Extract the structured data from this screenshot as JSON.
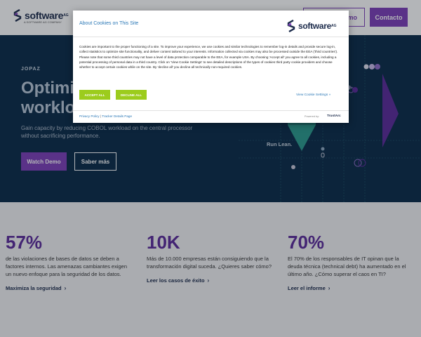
{
  "header": {
    "logo_text": "software",
    "logo_sup": "AG",
    "logo_tagline": "A SOFTWARE AG COMPANY",
    "demo_label": "emo",
    "contact_label": "Contacto"
  },
  "hero": {
    "eyebrow": "JOPAZ",
    "title_line1": "Optimiz",
    "title_line2": "workloa",
    "description": "Gain capacity by reducing COBOL workload on the central processor without sacrificing performance.",
    "watch_label": "Watch Demo",
    "more_label": "Saber más",
    "art_label": "Run Lean.",
    "art_label2": "ig."
  },
  "stats": [
    {
      "number": "57%",
      "text": "de las violaciones de bases de datos se deben a factores internos. Las amenazas cambiantes exigen un nuevo enfoque para la seguridad de los datos.",
      "link": "Maximiza la seguridad"
    },
    {
      "number": "10K",
      "text": "Más de 10.000 empresas están consiguiendo que la transformación digital suceda. ¿Quieres saber cómo?",
      "link": "Leer los casos de éxito"
    },
    {
      "number": "70%",
      "text": "El 70% de los responsables de IT opinan que la deuda técnica (technical debt) ha aumentado en el último año. ¿Cómo superar el caos en TI?",
      "link": "Leer el informe"
    }
  ],
  "cookie": {
    "title": "About Cookies on This Site",
    "logo_text": "software",
    "logo_sup": "AG",
    "body": "Cookies are important to the proper functioning of a site. To improve your experience, we use cookies and similar technologies to remember log-in details and provide secure log-in, collect statistics to optimize site functionality, and deliver content tailored to your interests. Information collected via cookies may also be processed outside the EEA ('third countries'). Please note that some third countries may not have a level of data protection comparable to the EEA, for example USA. By choosing 'Accept all' you agree to all cookies, including a potential processing of personal data in a third country. Click on 'View Cookie Settings' to see detailed descriptions of the types of cookies third party cookie providers and choose whether to accept certain cookies while on the site. By 'decline all' you decline all technically non-required cookies.",
    "accept_label": "ACCEPT ALL",
    "decline_label": "DECLINE ALL",
    "settings_label": "View Cookie Settings »",
    "privacy_label": "Privacy Policy",
    "separator": "|",
    "tracker_label": "Tracker Details Page",
    "powered_label": "Powered by:",
    "trustarc_label": "TrustArc"
  },
  "colors": {
    "brand_purple": "#7c3fb8",
    "hero_bg": "#0a2a47",
    "accent_green": "#9ccc1d",
    "teal": "#2a9a8c",
    "link_blue": "#2b78b6"
  }
}
